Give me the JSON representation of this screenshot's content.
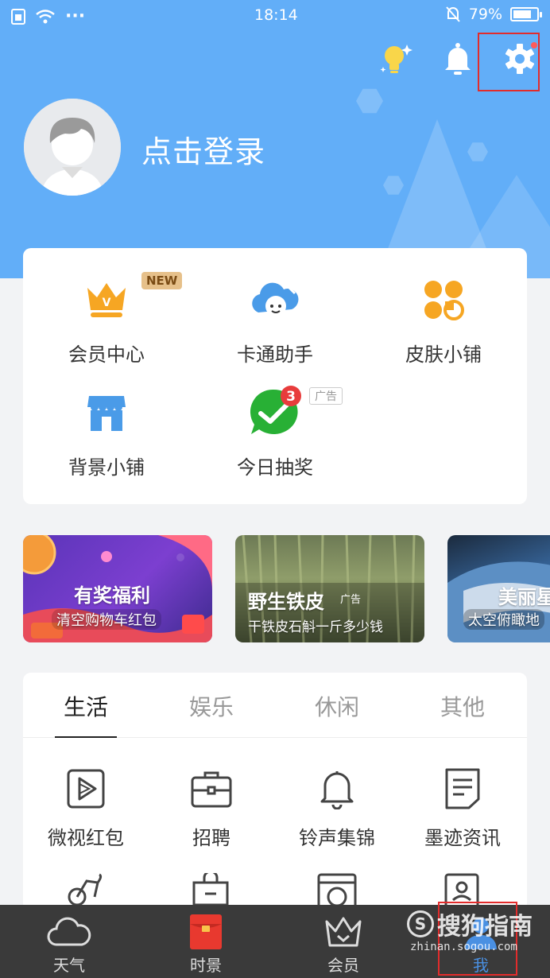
{
  "status": {
    "time": "18:14",
    "battery": "79%",
    "battery_level": 0.79,
    "dots": "···"
  },
  "profile": {
    "login_label": "点击登录"
  },
  "shortcuts": [
    {
      "label": "会员中心",
      "badge": "NEW"
    },
    {
      "label": "卡通助手"
    },
    {
      "label": "皮肤小铺"
    },
    {
      "label": "背景小铺"
    },
    {
      "label": "今日抽奖",
      "badge_count": "3",
      "ad_tag": "广告"
    }
  ],
  "banners": [
    {
      "title": "有奖福利",
      "subtitle": "清空购物车红包"
    },
    {
      "title": "野生铁皮",
      "ad_tag": "广告",
      "subtitle": "干铁皮石斛一斤多少钱"
    },
    {
      "title": "美丽星",
      "subtitle": "太空俯瞰地"
    }
  ],
  "tabs": [
    "生活",
    "娱乐",
    "休闲",
    "其他"
  ],
  "services": [
    {
      "label": "微视红包"
    },
    {
      "label": "招聘"
    },
    {
      "label": "铃声集锦"
    },
    {
      "label": "墨迹资讯"
    }
  ],
  "bottom_nav": [
    {
      "label": "天气"
    },
    {
      "label": "时景"
    },
    {
      "label": "会员"
    },
    {
      "label": "我"
    }
  ],
  "watermark": {
    "brand": "搜狗指南",
    "url": "zhinan.sogou.com",
    "logo_letter": "S"
  },
  "colors": {
    "header_blue": "#62aef8",
    "accent_yellow": "#f6a623",
    "accent_blue": "#4a90e2",
    "highlight_red": "#e22c2c"
  }
}
